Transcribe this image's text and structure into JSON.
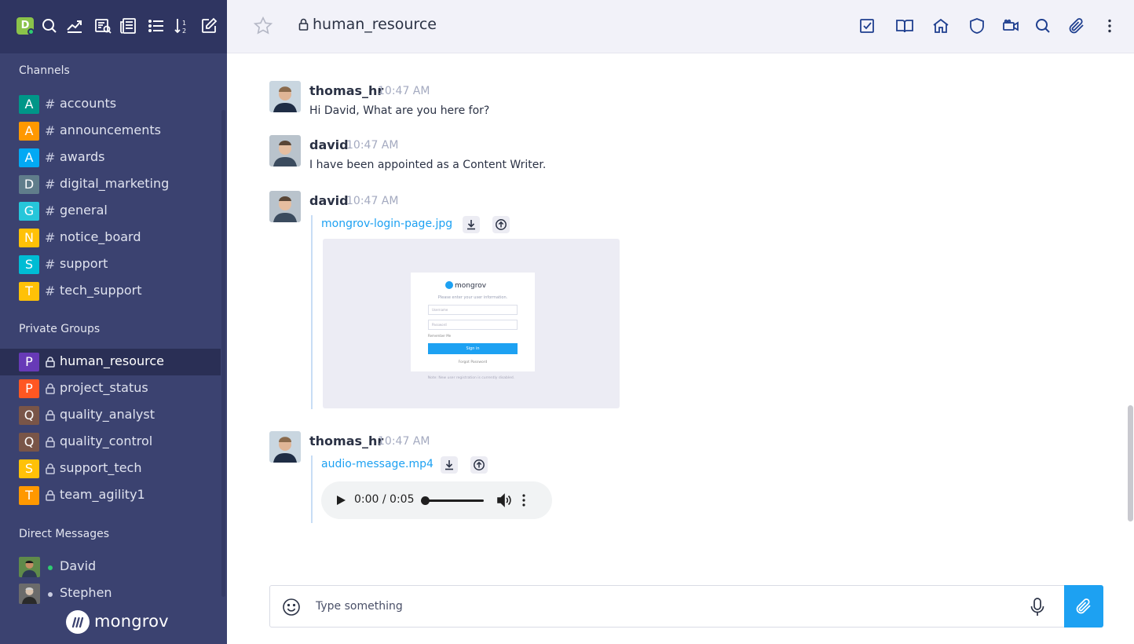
{
  "user": {
    "avatar_letter": "D",
    "avatar_color": "#8bc34a",
    "status": "online"
  },
  "toolbar": {
    "icons": [
      "search-icon",
      "analytics-icon",
      "directory-icon",
      "news-icon",
      "list-icon",
      "sort-icon",
      "edit-icon"
    ]
  },
  "sidebar": {
    "channels_title": "Channels",
    "channels": [
      {
        "letter": "A",
        "color": "#009688",
        "label": "accounts"
      },
      {
        "letter": "A",
        "color": "#ff9800",
        "label": "announcements"
      },
      {
        "letter": "A",
        "color": "#03a9f4",
        "label": "awards"
      },
      {
        "letter": "D",
        "color": "#607d8b",
        "label": "digital_marketing"
      },
      {
        "letter": "G",
        "color": "#26c6da",
        "label": "general"
      },
      {
        "letter": "N",
        "color": "#ffc107",
        "label": "notice_board"
      },
      {
        "letter": "S",
        "color": "#00bcd4",
        "label": "support"
      },
      {
        "letter": "T",
        "color": "#ffc107",
        "label": "tech_support"
      }
    ],
    "groups_title": "Private Groups",
    "groups": [
      {
        "letter": "P",
        "color": "#673ab7",
        "label": "human_resource",
        "active": true
      },
      {
        "letter": "P",
        "color": "#ff5722",
        "label": "project_status"
      },
      {
        "letter": "Q",
        "color": "#795548",
        "label": "quality_analyst"
      },
      {
        "letter": "Q",
        "color": "#795548",
        "label": "quality_control"
      },
      {
        "letter": "S",
        "color": "#ffc107",
        "label": "support_tech"
      },
      {
        "letter": "T",
        "color": "#ff9800",
        "label": "team_agility1"
      }
    ],
    "dm_title": "Direct Messages",
    "dms": [
      {
        "label": "David",
        "status_color": "#2ecc71"
      },
      {
        "label": "Stephen",
        "status_color": "#c9cce0"
      }
    ],
    "brand": "mongrov"
  },
  "header": {
    "room_title": "human_resource",
    "icons": [
      "tasks-icon",
      "book-icon",
      "home-icon",
      "shield-icon",
      "video-icon",
      "search-icon",
      "attachment-icon",
      "more-vertical-icon"
    ]
  },
  "messages": [
    {
      "user": "thomas_hr",
      "time": "10:47 AM",
      "text": "Hi David, What are you here for?"
    },
    {
      "user": "david",
      "time": "10:47 AM",
      "text": "I have been appointed as a Content Writer."
    },
    {
      "user": "david",
      "time": "10:47 AM",
      "attachment": {
        "name": "mongrov-login-page.jpg",
        "preview": {
          "brand": "mongrov",
          "subtitle": "Please enter your user information.",
          "username_placeholder": "Username",
          "password_placeholder": "Password",
          "remember": "Remember Me",
          "sign_in": "Sign in",
          "forgot": "Forgot Password",
          "note": "Note: New user registration is currently disabled."
        }
      }
    },
    {
      "user": "thomas_hr",
      "time": "10:47 AM",
      "attachment": {
        "name": "audio-message.mp4",
        "audio_time": "0:00 / 0:05"
      }
    }
  ],
  "composer": {
    "placeholder": "Type something"
  },
  "colors": {
    "sidebar_bg": "#3b4270",
    "accent": "#1da1f2",
    "header_bg": "#f2f2f9"
  }
}
